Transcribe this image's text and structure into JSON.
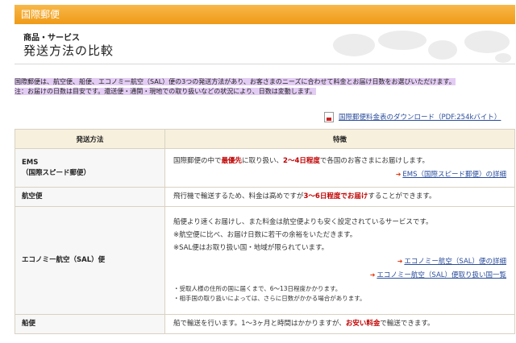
{
  "header": {
    "title": "国際郵便"
  },
  "title_box": {
    "subtitle": "商品・サービス",
    "title": "発送方法の比較"
  },
  "intro": {
    "line1": "国際郵便は、航空便、船便、エコノミー航空（SAL）便の3つの発送方法があり、お客さまのニーズに合わせて料金とお届け日数をお選びいただけます。",
    "line2": "注：お届けの日数は目安です。還送便・通関・現地での取り扱いなどの状況により、日数は変動します。"
  },
  "download": {
    "label": "国際郵便料金表のダウンロード（PDF:254kバイト）",
    "icon": "pdf-icon"
  },
  "table": {
    "headers": [
      "発送方法",
      "特徴"
    ],
    "rows": {
      "ems": {
        "method_line1": "EMS",
        "method_line2": "（国際スピード郵便）",
        "text_a": "国際郵便の中で",
        "text_b": "最優先",
        "text_c": "に取り扱い、",
        "text_d": "2〜4日程度",
        "text_e": "で各国のお客さまにお届けします。",
        "link": "EMS（国際スピード郵便）の詳細"
      },
      "air": {
        "method": "航空便",
        "text_a": "飛行機で輸送するため、料金は高めですが",
        "text_b": "3〜6日程度でお届け",
        "text_c": "することができます。"
      },
      "sal": {
        "method": "エコノミー航空（SAL）便",
        "text1": "船便より速くお届けし、また料金は航空便よりも安く設定されているサービスです。",
        "note1": "※航空便に比べ、お届け日数に若干の余裕をいただきます。",
        "note2": "※SAL便はお取り扱い国・地域が限られています。",
        "link1": "エコノミー航空（SAL）便の詳細",
        "link2": "エコノミー航空（SAL）便取り扱い国一覧",
        "small1": "・受取人様の住所の国に届くまで、6〜13日程度かかります。",
        "small2": "・相手国の取り扱いによっては、さらに日数がかかる場合があります。"
      },
      "ship": {
        "method": "船便",
        "text_a": "船で輸送を行います。1〜3ヶ月と時間はかかりますが、",
        "text_b": "お安い料金",
        "text_c": "で輸送できます。"
      }
    }
  },
  "colors": {
    "header": "#ef9a16",
    "highlight": "#e3ccf4",
    "accent_red": "#c00000",
    "link": "#2a4d9c"
  }
}
